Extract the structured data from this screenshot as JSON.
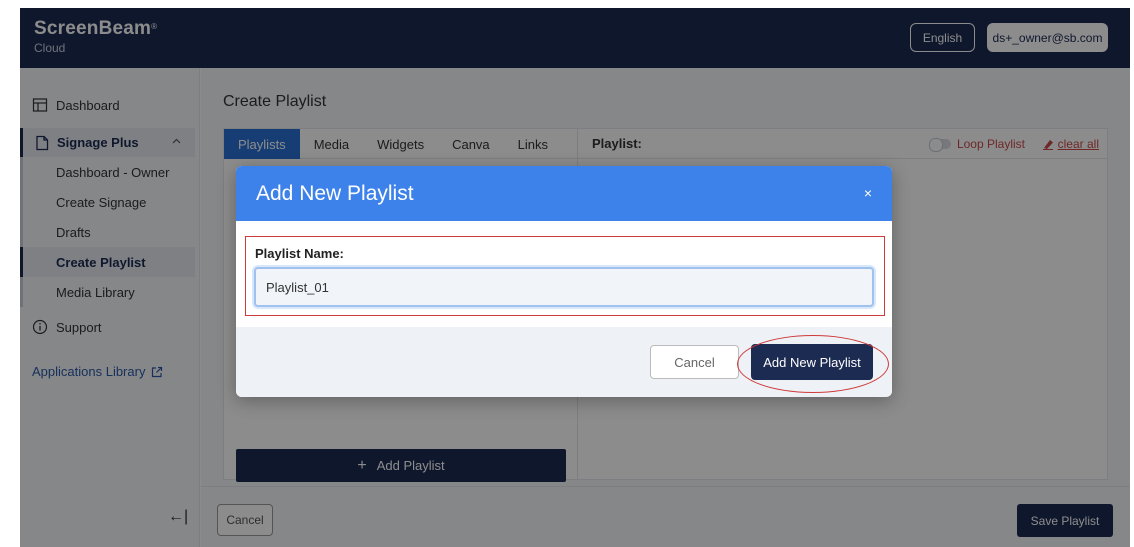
{
  "header": {
    "brand_name": "ScreenBeam",
    "brand_mark": "®",
    "brand_sub": "Cloud",
    "language": "English",
    "user": "ds+_owner@sb.com"
  },
  "sidebar": {
    "dashboard": "Dashboard",
    "group_label": "Signage Plus",
    "items": [
      {
        "label": "Dashboard - Owner"
      },
      {
        "label": "Create Signage"
      },
      {
        "label": "Drafts"
      },
      {
        "label": "Create Playlist"
      },
      {
        "label": "Media Library"
      }
    ],
    "active_item": "Create Playlist",
    "support": "Support",
    "applications_library": "Applications Library",
    "collapse_glyph": "←|"
  },
  "main": {
    "title": "Create Playlist",
    "tabs": [
      {
        "label": "Playlists"
      },
      {
        "label": "Media"
      },
      {
        "label": "Widgets"
      },
      {
        "label": "Canva"
      },
      {
        "label": "Links"
      }
    ],
    "active_tab": "Playlists",
    "playlist_header": "Playlist:",
    "loop_label": "Loop Playlist",
    "loop_enabled": false,
    "clear_all": "clear all",
    "add_playlist": "Add Playlist",
    "cancel": "Cancel",
    "save": "Save Playlist"
  },
  "modal": {
    "title": "Add New Playlist",
    "close_glyph": "×",
    "field_label": "Playlist Name:",
    "field_value": "Playlist_01",
    "cancel": "Cancel",
    "submit": "Add New Playlist"
  },
  "colors": {
    "navy": "#1c2b52",
    "accent_blue": "#3d82ea",
    "annotation_red": "#cf3a3a"
  }
}
